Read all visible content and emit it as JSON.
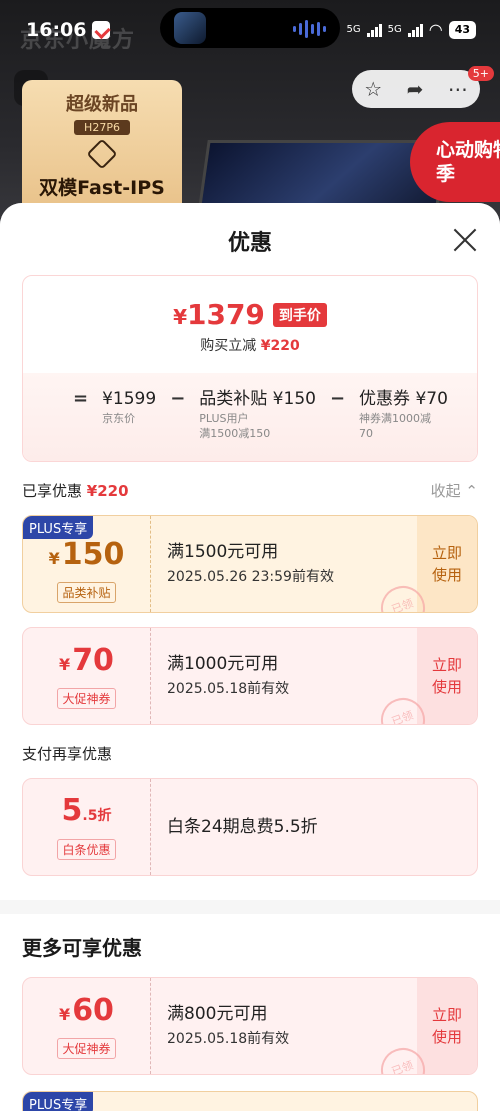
{
  "status_bar": {
    "time": "16:06",
    "network_1": "5G",
    "network_2": "5G",
    "battery": "43"
  },
  "background_page": {
    "watermark": "京东小魔方",
    "badge_count": "5+",
    "promo_kicker": "超级新品",
    "promo_model": "H27P6",
    "promo_title": "双模Fast-IPS",
    "seal_text": "心动购物季"
  },
  "sheet": {
    "title": "优惠",
    "price": {
      "currency": "¥",
      "final": "1379",
      "tag": "到手价",
      "save_label": "购买立减",
      "save_amount": "¥220"
    },
    "formula": {
      "op_eq": "=",
      "op_minus": "−",
      "base_main": "¥1599",
      "base_note": "京东价",
      "sub1_main": "品类补贴 ¥150",
      "sub1_note_1": "PLUS用户",
      "sub1_note_2": "满1500减150",
      "sub2_main": "优惠券 ¥70",
      "sub2_note_1": "神券满1000减",
      "sub2_note_2": "70"
    },
    "enjoyed": {
      "label": "已享优惠",
      "amount": "¥220",
      "collapse": "收起 ⌃"
    },
    "coupons": [
      {
        "badge": "PLUS专享",
        "currency": "¥",
        "amount": "150",
        "type": "品类补贴",
        "condition": "满1500元可用",
        "validity": "2025.05.26 23:59前有效",
        "action_1": "立即",
        "action_2": "使用",
        "stamp": "已领"
      },
      {
        "currency": "¥",
        "amount": "70",
        "type": "大促神券",
        "condition": "满1000元可用",
        "validity": "2025.05.18前有效",
        "action_1": "立即",
        "action_2": "使用",
        "stamp": "已领"
      }
    ],
    "pay": {
      "label": "支付再享优惠",
      "amount": "5",
      "amount_suffix": ".5折",
      "type": "白条优惠",
      "desc": "白条24期息费5.5折"
    },
    "more": {
      "title": "更多可享优惠",
      "coupon": {
        "currency": "¥",
        "amount": "60",
        "type": "大促神券",
        "condition": "满800元可用",
        "validity": "2025.05.18前有效",
        "action_1": "立即",
        "action_2": "使用",
        "stamp": "已领"
      },
      "partial_badge": "PLUS专享"
    }
  }
}
